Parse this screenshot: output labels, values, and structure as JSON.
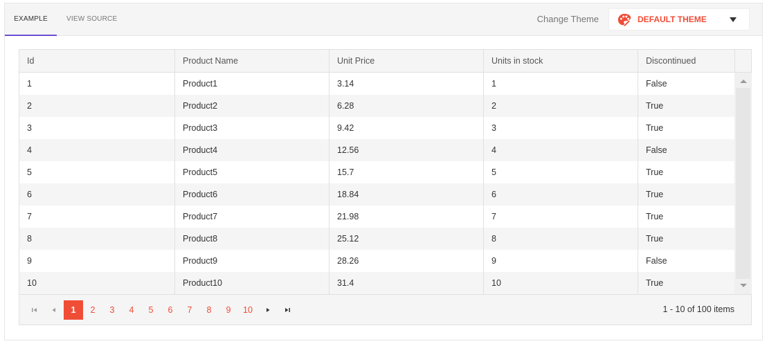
{
  "tabs": [
    {
      "label": "Example",
      "active": true
    },
    {
      "label": "View Source",
      "active": false
    }
  ],
  "theme": {
    "label": "Change Theme",
    "selected": "Default Theme",
    "accent": "#f04d37",
    "icon": "palette-icon"
  },
  "grid": {
    "columns": [
      "Id",
      "Product Name",
      "Unit Price",
      "Units in stock",
      "Discontinued"
    ],
    "rows": [
      [
        "1",
        "Product1",
        "3.14",
        "1",
        "False"
      ],
      [
        "2",
        "Product2",
        "6.28",
        "2",
        "True"
      ],
      [
        "3",
        "Product3",
        "9.42",
        "3",
        "True"
      ],
      [
        "4",
        "Product4",
        "12.56",
        "4",
        "False"
      ],
      [
        "5",
        "Product5",
        "15.7",
        "5",
        "True"
      ],
      [
        "6",
        "Product6",
        "18.84",
        "6",
        "True"
      ],
      [
        "7",
        "Product7",
        "21.98",
        "7",
        "True"
      ],
      [
        "8",
        "Product8",
        "25.12",
        "8",
        "True"
      ],
      [
        "9",
        "Product9",
        "28.26",
        "9",
        "False"
      ],
      [
        "10",
        "Product10",
        "31.4",
        "10",
        "True"
      ]
    ]
  },
  "pager": {
    "pages": [
      "1",
      "2",
      "3",
      "4",
      "5",
      "6",
      "7",
      "8",
      "9",
      "10"
    ],
    "current": "1",
    "info": "1 - 10 of 100 items",
    "nav_icons": [
      "first-page-icon",
      "prev-page-icon",
      "next-page-icon",
      "last-page-icon"
    ]
  }
}
